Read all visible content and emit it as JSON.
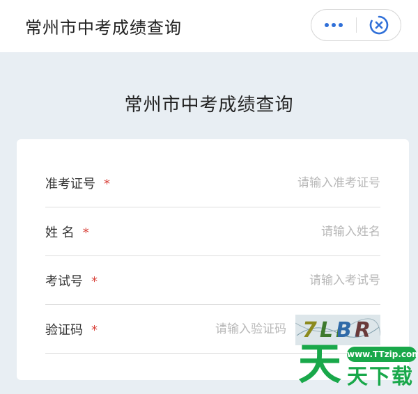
{
  "nav": {
    "title": "常州市中考成绩查询",
    "more_icon": "more-dots-icon",
    "close_icon": "close-circle-icon"
  },
  "page": {
    "title": "常州市中考成绩查询"
  },
  "form": {
    "required_mark": "*",
    "fields": [
      {
        "label": "准考证号",
        "placeholder": "请输入准考证号",
        "value": ""
      },
      {
        "label": "姓 名",
        "placeholder": "请输入姓名",
        "value": ""
      },
      {
        "label": "考试号",
        "placeholder": "请输入考试号",
        "value": ""
      },
      {
        "label": "验证码",
        "placeholder": "请输入验证码",
        "value": ""
      }
    ],
    "captcha_text": "7LBR"
  },
  "watermark": {
    "url": "www.TTzip.com",
    "big_char": "天",
    "rest_text": "天下载"
  },
  "colors": {
    "accent": "#2f6fd8",
    "required": "#d9433b",
    "background": "#e8eef3",
    "watermark_green": "#19a84a"
  }
}
